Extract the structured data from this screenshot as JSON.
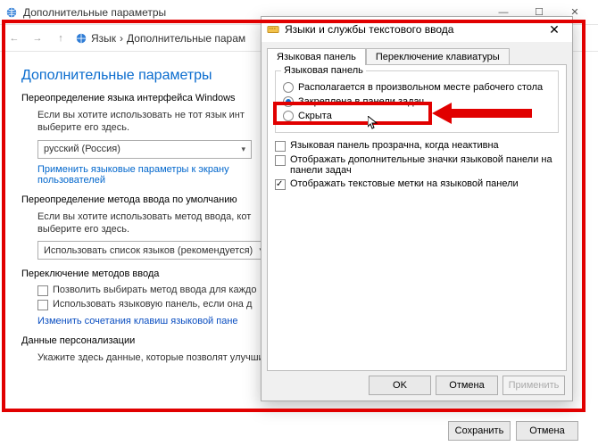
{
  "main": {
    "title": "Дополнительные параметры",
    "breadcrumb": {
      "root": "Язык",
      "sep": "›",
      "current": "Дополнительные парам"
    },
    "heading": "Дополнительные параметры",
    "sections": {
      "override": {
        "title": "Переопределение языка интерфейса Windows",
        "desc": "Если вы хотите использовать не тот язык инт\nвыберите его здесь.",
        "combo": "русский (Россия)",
        "link": "Применить языковые параметры к экрану\nпользователей"
      },
      "input": {
        "title": "Переопределение метода ввода по умолчанию",
        "desc": "Если вы хотите использовать метод ввода, кот\nвыберите его здесь.",
        "combo": "Использовать список языков (рекомендуется)"
      },
      "switch": {
        "title": "Переключение методов ввода",
        "chk1": "Позволить выбирать метод ввода для каждо",
        "chk2": "Использовать языковую панель, если она д",
        "link": "Изменить сочетания клавиш языковой пане"
      },
      "pers": {
        "title": "Данные персонализации",
        "desc": "Укажите здесь данные, которые позволят улучшить распознавание рукописного ввода и прогнозирование текста"
      }
    },
    "footer": {
      "save": "Сохранить",
      "cancel": "Отмена"
    }
  },
  "dialog": {
    "title": "Языки и службы текстового ввода",
    "close": "✕",
    "tabs": {
      "active": "Языковая панель",
      "other": "Переключение клавиатуры"
    },
    "group_legend": "Языковая панель",
    "radios": {
      "r1": "Располагается в произвольном месте рабочего стола",
      "r2": "Закреплена в панели задач",
      "r3": "Скрыта"
    },
    "checks": {
      "c1": "Языковая панель прозрачна, когда неактивна",
      "c2": "Отображать дополнительные значки языковой панели на панели задач",
      "c3": "Отображать текстовые метки на языковой панели"
    },
    "footer": {
      "ok": "OK",
      "cancel": "Отмена",
      "apply": "Применить"
    }
  },
  "winbtns": {
    "min": "—",
    "max": "☐",
    "close": "✕"
  }
}
